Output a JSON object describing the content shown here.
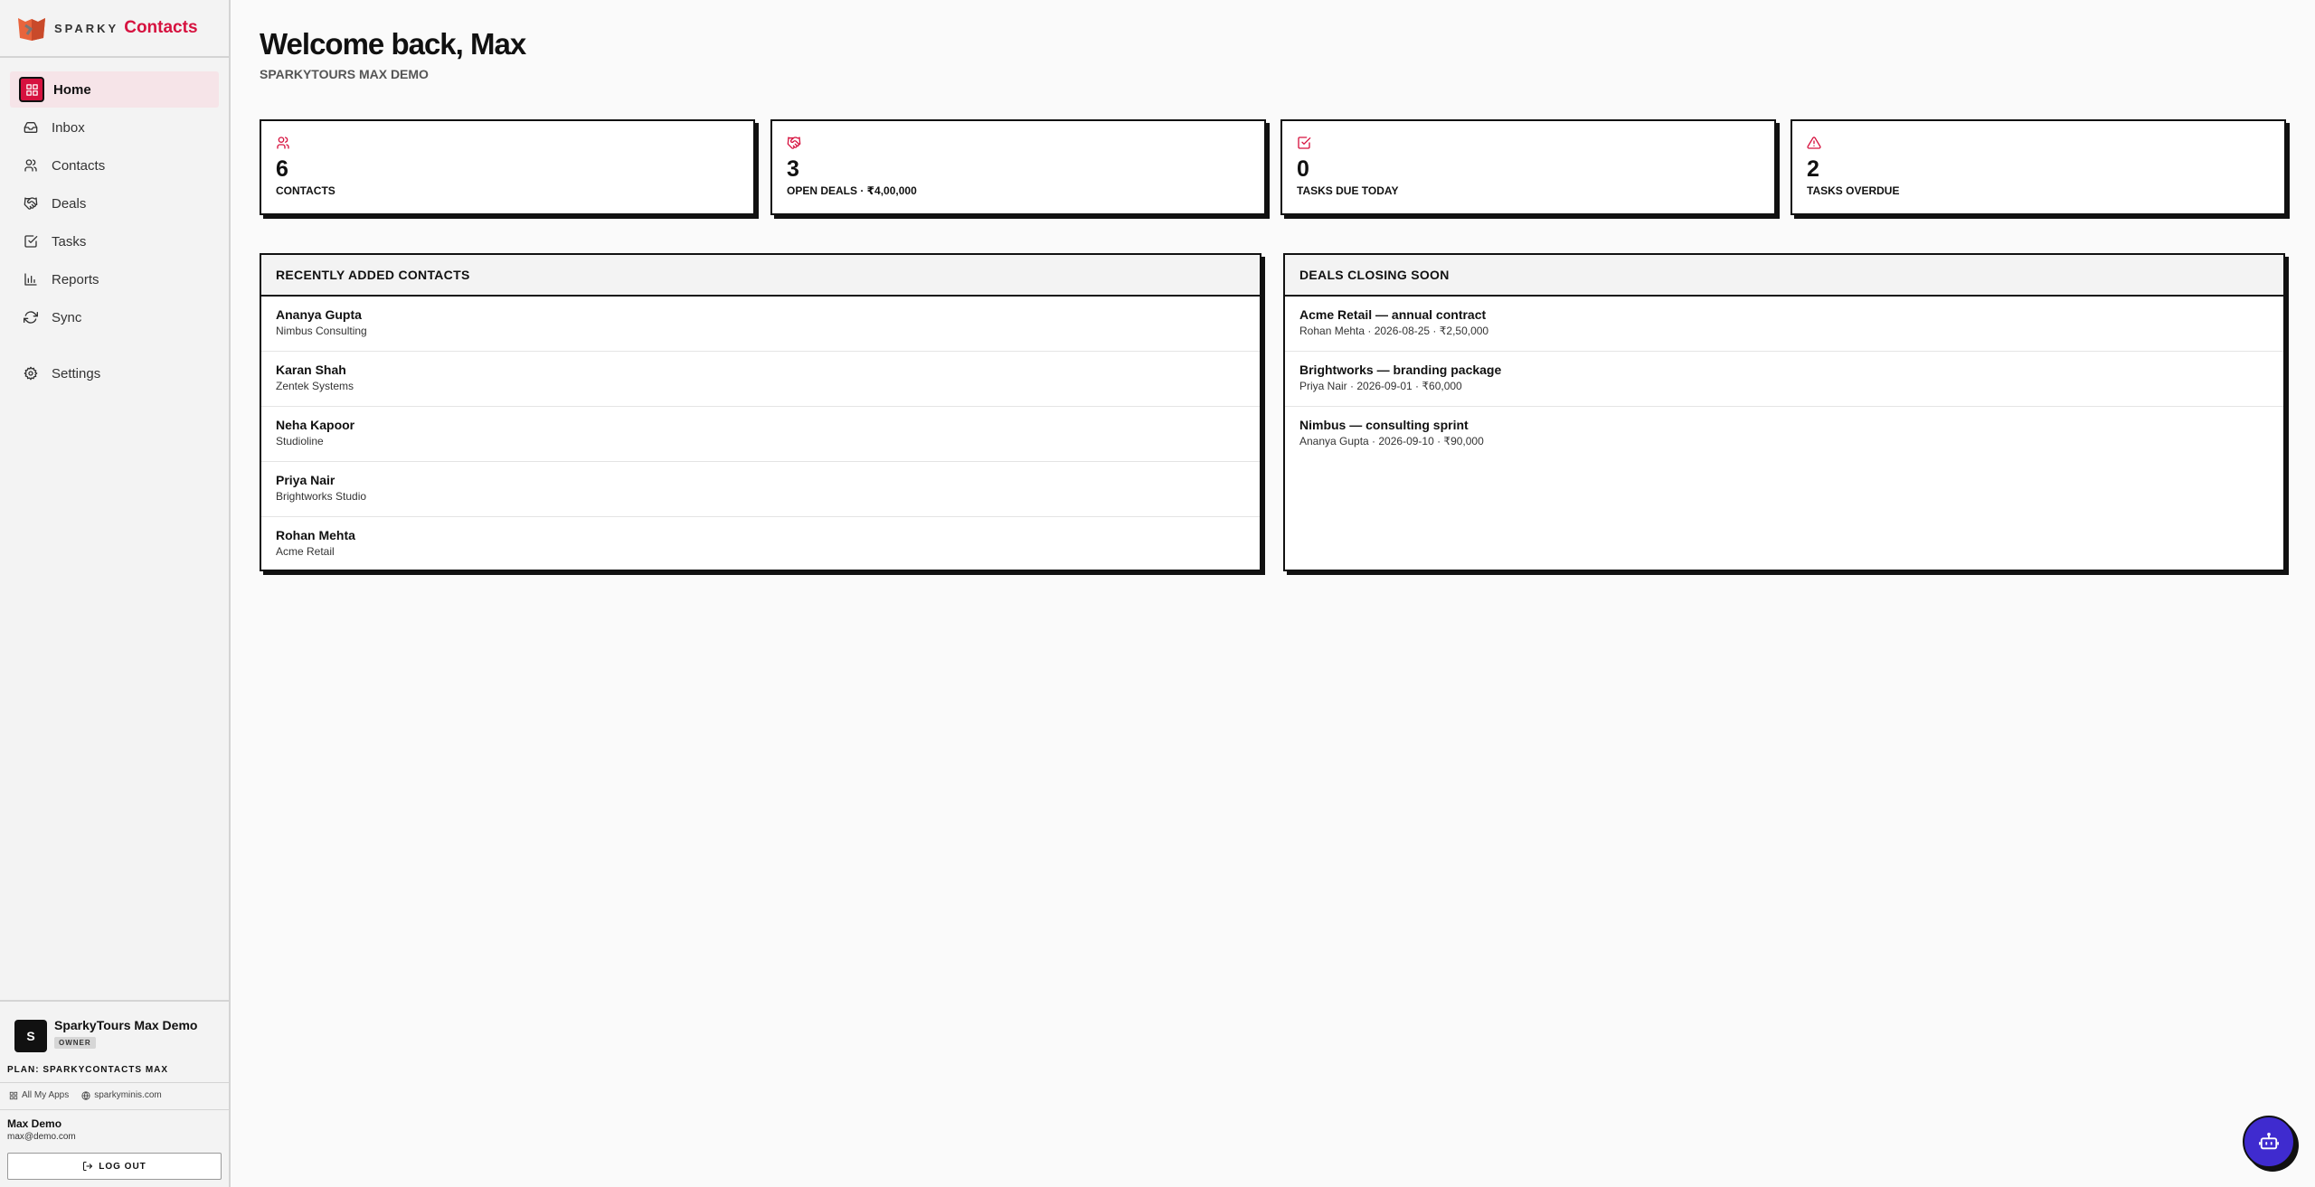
{
  "brand": {
    "sparky": "SPARKY",
    "app": "Contacts",
    "accent": "#d6123f"
  },
  "nav": {
    "home": "Home",
    "inbox": "Inbox",
    "contacts": "Contacts",
    "deals": "Deals",
    "tasks": "Tasks",
    "reports": "Reports",
    "sync": "Sync",
    "settings": "Settings"
  },
  "org": {
    "avatar": "S",
    "name": "SparkyTours Max Demo",
    "role": "OWNER",
    "plan": "PLAN: SPARKYCONTACTS MAX"
  },
  "links": {
    "all_apps": "All My Apps",
    "site": "sparkyminis.com"
  },
  "user": {
    "name": "Max Demo",
    "email": "max@demo.com",
    "logout": "LOG OUT"
  },
  "header": {
    "welcome": "Welcome back, Max",
    "org": "SPARKYTOURS MAX DEMO"
  },
  "stats": [
    {
      "value": "6",
      "label": "CONTACTS",
      "icon": "users-icon"
    },
    {
      "value": "3",
      "label": "OPEN DEALS · ₹4,00,000",
      "icon": "handshake-icon"
    },
    {
      "value": "0",
      "label": "TASKS DUE TODAY",
      "icon": "check-square-icon"
    },
    {
      "value": "2",
      "label": "TASKS OVERDUE",
      "icon": "alert-triangle-icon"
    }
  ],
  "recent_contacts": {
    "title": "RECENTLY ADDED CONTACTS",
    "items": [
      {
        "name": "Ananya Gupta",
        "company": "Nimbus Consulting"
      },
      {
        "name": "Karan Shah",
        "company": "Zentek Systems"
      },
      {
        "name": "Neha Kapoor",
        "company": "Studioline"
      },
      {
        "name": "Priya Nair",
        "company": "Brightworks Studio"
      },
      {
        "name": "Rohan Mehta",
        "company": "Acme Retail"
      }
    ]
  },
  "deals_closing": {
    "title": "DEALS CLOSING SOON",
    "items": [
      {
        "title": "Acme Retail — annual contract",
        "meta": "Rohan Mehta · 2026-08-25 · ₹2,50,000"
      },
      {
        "title": "Brightworks — branding package",
        "meta": "Priya Nair · 2026-09-01 · ₹60,000"
      },
      {
        "title": "Nimbus — consulting sprint",
        "meta": "Ananya Gupta · 2026-09-10 · ₹90,000"
      }
    ]
  },
  "assistant": {
    "icon": "bot-icon",
    "color": "#3f2bcf"
  }
}
